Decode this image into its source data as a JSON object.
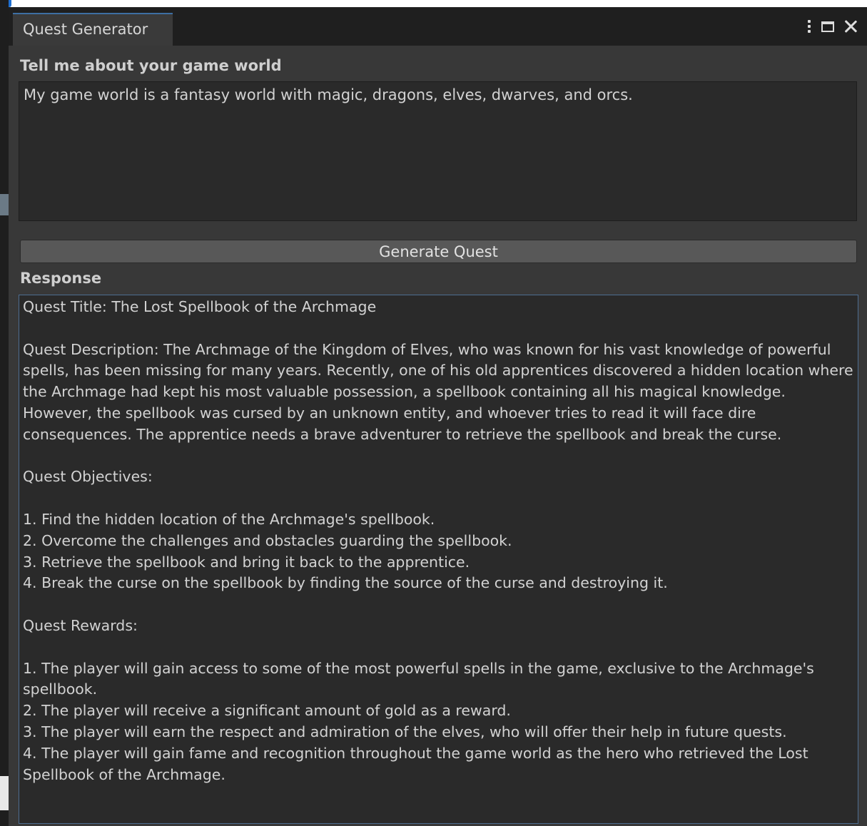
{
  "window": {
    "tab_title": "Quest Generator"
  },
  "world": {
    "label": "Tell me about your game world",
    "value": "My game world is a fantasy world with magic, dragons, elves, dwarves, and orcs."
  },
  "generate_button_label": "Generate Quest",
  "response": {
    "label": "Response",
    "title_line": "Quest Title: The Lost Spellbook of the Archmage",
    "description": "Quest Description: The Archmage of the Kingdom of Elves, who was known for his vast knowledge of powerful spells, has been missing for many years. Recently, one of his old apprentices discovered a hidden location where the Archmage had kept his most valuable possession, a spellbook containing all his magical knowledge. However, the spellbook was cursed by an unknown entity, and whoever tries to read it will face dire consequences. The apprentice needs a brave adventurer to retrieve the spellbook and break the curse.",
    "objectives_heading": "Quest Objectives:",
    "objectives": [
      "1. Find the hidden location of the Archmage's spellbook.",
      "2. Overcome the challenges and obstacles guarding the spellbook.",
      "3. Retrieve the spellbook and bring it back to the apprentice.",
      "4. Break the curse on the spellbook by finding the source of the curse and destroying it."
    ],
    "rewards_heading": "Quest Rewards:",
    "rewards": [
      "1. The player will gain access to some of the most powerful spells in the game, exclusive to the Archmage's spellbook.",
      "2. The player will receive a significant amount of gold as a reward.",
      "3. The player will earn the respect and admiration of the elves, who will offer their help in future quests.",
      "4. The player will gain fame and recognition throughout the game world as the hero who retrieved the Lost Spellbook of the Archmage."
    ]
  },
  "icons": {
    "menu": "kebab-menu-icon",
    "maximize": "maximize-icon",
    "close": "close-icon"
  },
  "colors": {
    "panel_bg": "#383838",
    "field_bg": "#2a2a2a",
    "button_bg": "#585858",
    "focus_border": "#4d6d91",
    "tab_accent": "#3d6fa3"
  }
}
